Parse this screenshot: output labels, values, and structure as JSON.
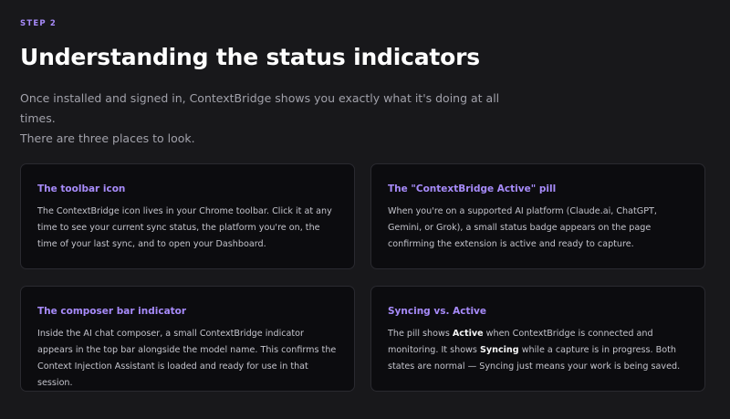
{
  "header": {
    "step": "STEP 2",
    "title": "Understanding the status indicators",
    "intro_line1": "Once installed and signed in, ContextBridge shows you exactly what it's doing at all times.",
    "intro_line2": "There are three places to look."
  },
  "cards": [
    {
      "title": "The toolbar icon",
      "body": "The ContextBridge icon lives in your Chrome toolbar. Click it at any time to see your current sync status, the platform you're on, the time of your last sync, and to open your Dashboard."
    },
    {
      "title": "The \"ContextBridge Active\" pill",
      "body": "When you're on a supported AI platform (Claude.ai, ChatGPT, Gemini, or Grok), a small status badge appears on the page confirming the extension is active and ready to capture."
    },
    {
      "title": "The composer bar indicator",
      "body": "Inside the AI chat composer, a small ContextBridge indicator appears in the top bar alongside the model name. This confirms the Context Injection Assistant is loaded and ready for use in that session."
    },
    {
      "title": "Syncing vs. Active",
      "body_part1": "The pill shows ",
      "body_bold1": "Active",
      "body_part2": " when ContextBridge is connected and monitoring. It shows ",
      "body_bold2": "Syncing",
      "body_part3": " while a capture is in progress. Both states are normal — Syncing just means your work is being saved."
    }
  ]
}
